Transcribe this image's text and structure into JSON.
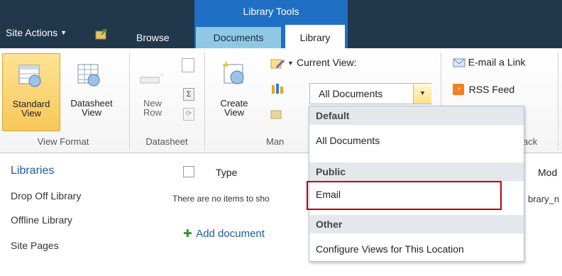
{
  "top": {
    "site_actions": "Site Actions",
    "library_tools": "Library Tools",
    "tabs": {
      "browse": "Browse",
      "documents": "Documents",
      "library": "Library"
    }
  },
  "ribbon": {
    "view_format": {
      "label": "View Format",
      "standard_line1": "Standard",
      "standard_line2": "View",
      "datasheet_line1": "Datasheet",
      "datasheet_line2": "View"
    },
    "datasheet": {
      "label": "Datasheet",
      "new_line1": "New",
      "new_line2": "Row"
    },
    "manage_views": {
      "label_partial": "Man",
      "create_line1": "Create",
      "create_line2": "View",
      "current_view_label": "Current View:",
      "current_view_value": "All Documents"
    },
    "share_track": {
      "label_partial": "ack",
      "email_link": "E-mail a Link",
      "rss": "RSS Feed"
    }
  },
  "dropdown": {
    "default_hdr": "Default",
    "all_documents": "All Documents",
    "public_hdr": "Public",
    "email": "Email",
    "other_hdr": "Other",
    "configure": "Configure Views for This Location"
  },
  "left_nav": {
    "header": "Libraries",
    "items": [
      "Drop Off Library",
      "Offline Library",
      "Site Pages"
    ]
  },
  "list": {
    "col_type": "Type",
    "col_modified_partial": "Mod",
    "empty_partial": "There are no items to sho",
    "right_partial": "brary_n",
    "add_document": "Add document"
  },
  "colors": {
    "topbar": "#21374c",
    "library_tools": "#1f6fc4",
    "documents_tab": "#8fc8e4",
    "highlight_border": "#c00000",
    "link": "#1f5aa0"
  }
}
